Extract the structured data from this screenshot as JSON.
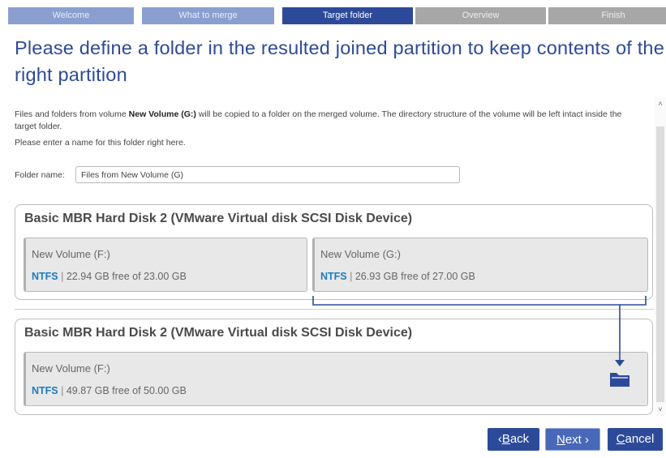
{
  "steps": [
    {
      "label": "Welcome"
    },
    {
      "label": "What to merge"
    },
    {
      "label": "Target folder"
    },
    {
      "label": "Overview"
    },
    {
      "label": "Finish"
    }
  ],
  "title": "Please define a folder in the resulted joined partition to keep contents of the right partition",
  "description": {
    "pre": "Files and folders from volume ",
    "volume": "New Volume (G:)",
    "post": " will be copied to a folder on the merged volume. The directory structure of the volume will be left intact inside the target folder."
  },
  "description2": "Please enter a name for this folder right here.",
  "folder": {
    "label": "Folder name:",
    "value": "Files from New Volume (G)"
  },
  "disks": [
    {
      "title": "Basic MBR Hard Disk 2 (VMware Virtual disk SCSI Disk Device)",
      "partitions": [
        {
          "name": "New Volume (F:)",
          "fs": "NTFS",
          "sep": "|",
          "size": "22.94 GB free of 23.00 GB"
        },
        {
          "name": "New Volume (G:)",
          "fs": "NTFS",
          "sep": "|",
          "size": "26.93 GB free of 27.00 GB"
        }
      ]
    },
    {
      "title": "Basic MBR Hard Disk 2 (VMware Virtual disk SCSI Disk Device)",
      "partitions": [
        {
          "name": "New Volume (F:)",
          "fs": "NTFS",
          "sep": "|",
          "size": "49.87 GB free of 50.00 GB"
        }
      ]
    }
  ],
  "buttons": {
    "back_arrow": "‹",
    "back_key": "B",
    "back_rest": "ack",
    "next_key": "N",
    "next_rest": "ext",
    "next_arrow": "›",
    "cancel_key": "C",
    "cancel_rest": "ancel"
  },
  "icons": {
    "target": "folder-icon",
    "scroll_up": "chevron-up-icon",
    "scroll_down": "chevron-down-icon"
  },
  "colors": {
    "accent": "#2d4a9a",
    "step_done": "#8a9fd0",
    "step_todo": "#a7a7a7",
    "fs_label": "#1c7cc0"
  }
}
